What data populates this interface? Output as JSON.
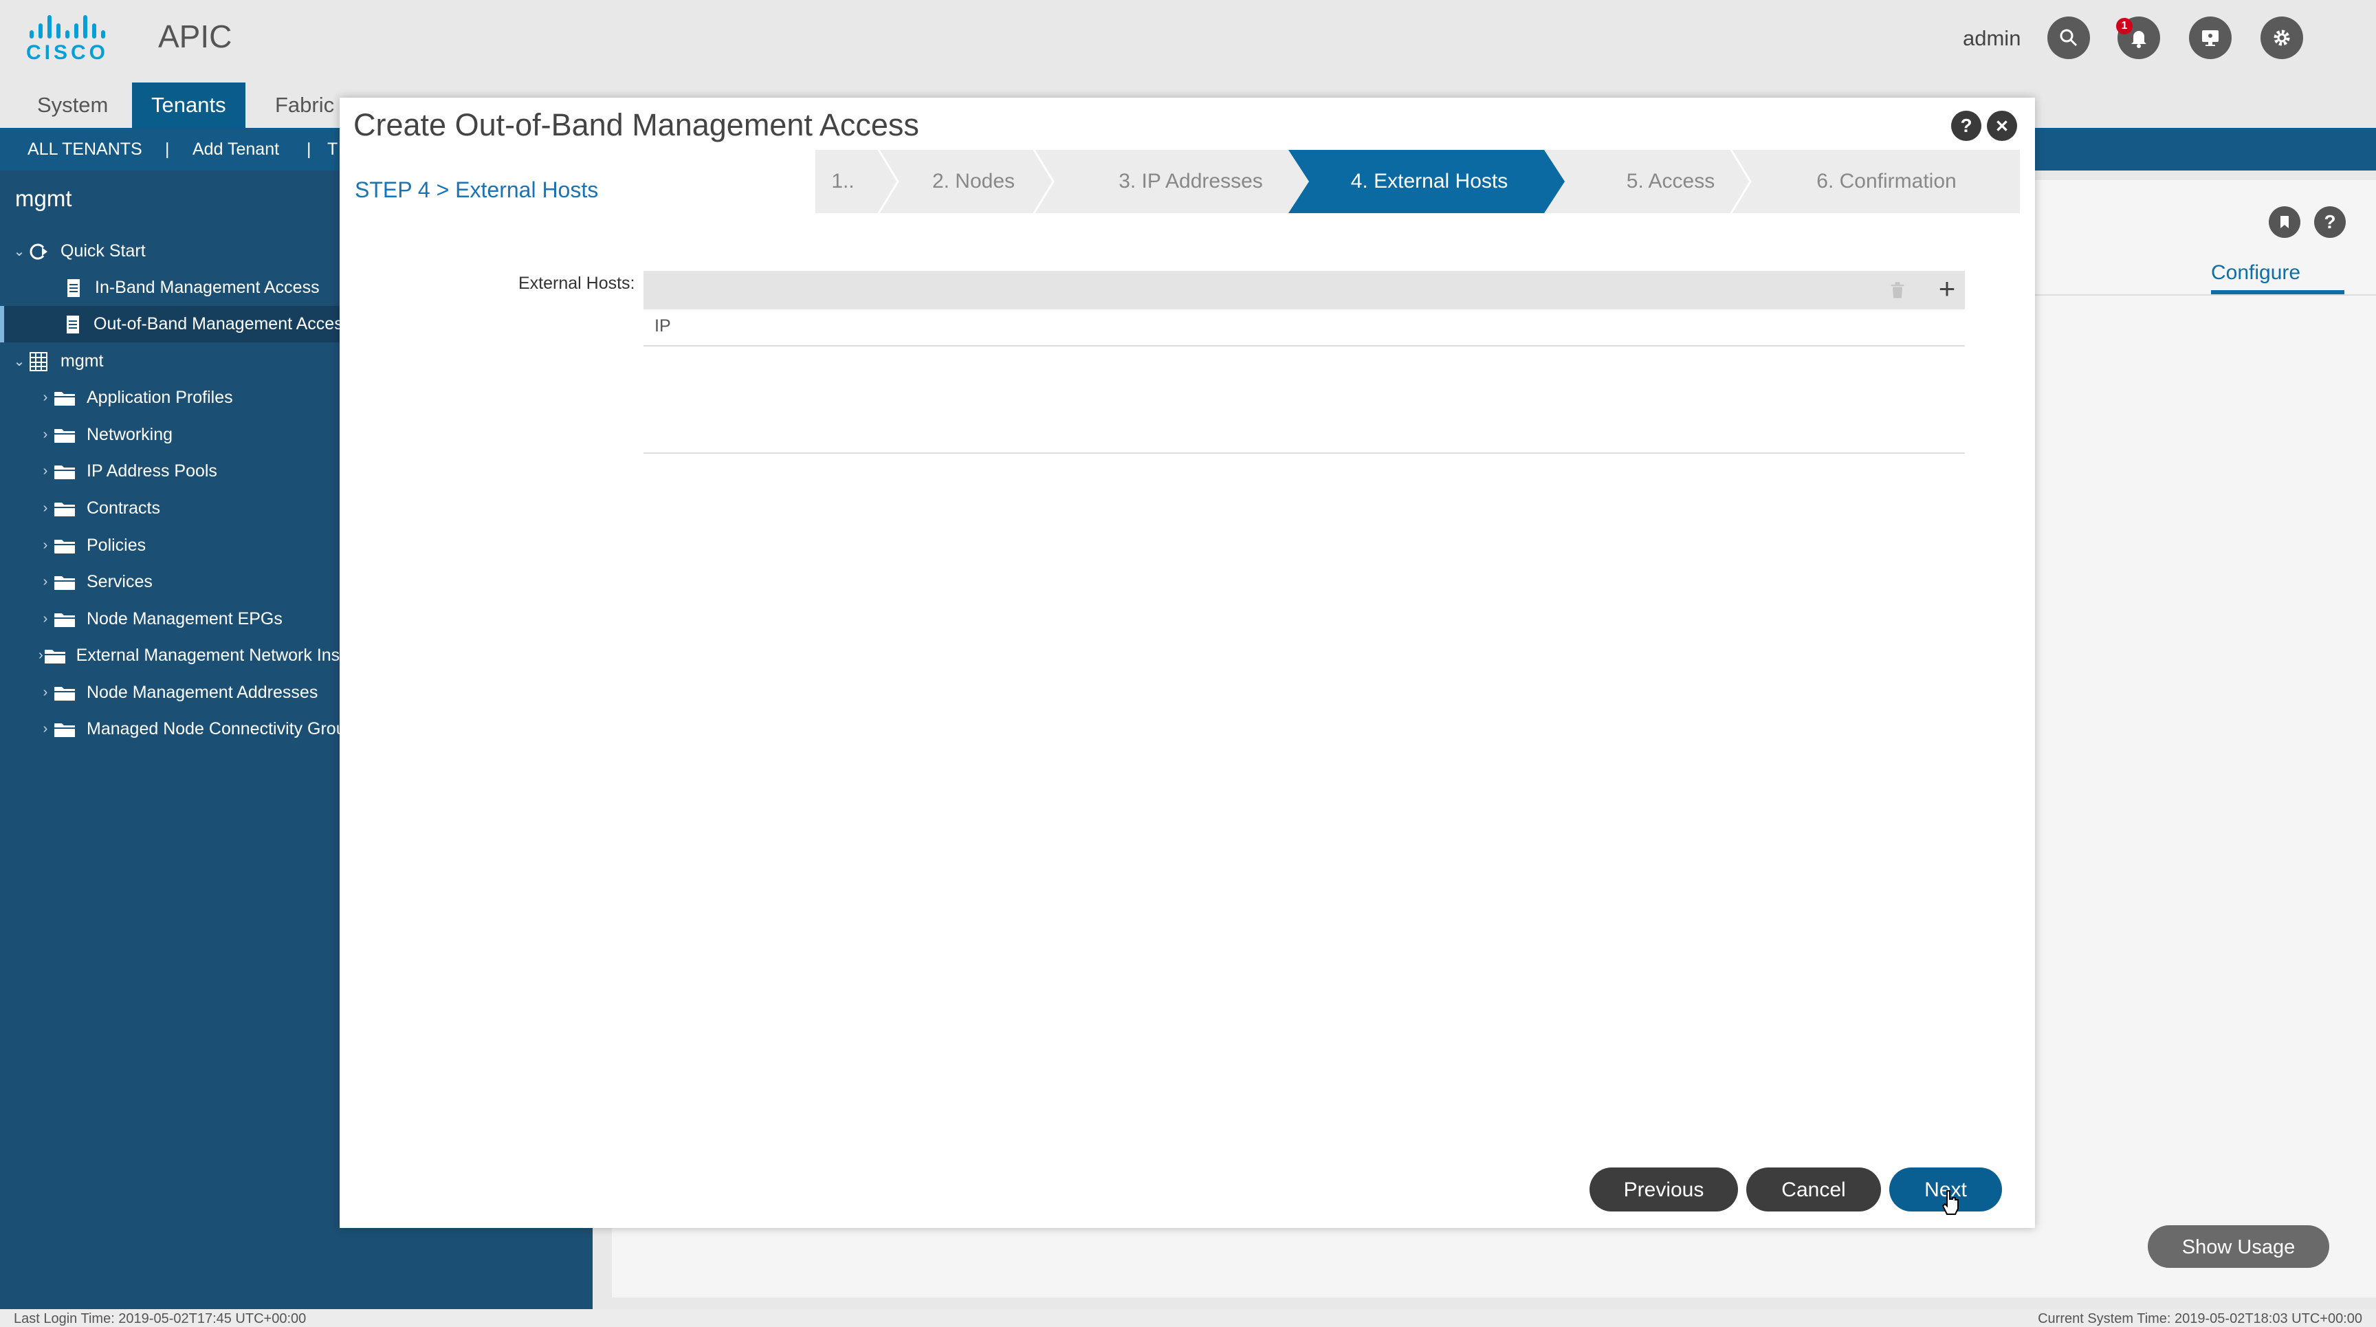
{
  "header": {
    "logo_text": "CISCO",
    "app_title": "APIC",
    "user": "admin",
    "notification_count": "1",
    "icons": [
      "search-icon",
      "bell-icon",
      "monitor-icon",
      "gear-icon"
    ]
  },
  "main_tabs": [
    {
      "label": "System"
    },
    {
      "label": "Tenants"
    },
    {
      "label": "Fabric"
    }
  ],
  "subnav": {
    "all_tenants": "ALL TENANTS",
    "separator": "|",
    "add_tenant": "Add Tenant",
    "partial": "T"
  },
  "sidebar": {
    "title": "mgmt",
    "items": [
      {
        "label": "Quick Start",
        "icon": "quickstart-icon"
      },
      {
        "label": "In-Band Management Access",
        "icon": "document-icon"
      },
      {
        "label": "Out-of-Band Management Access",
        "icon": "document-icon"
      },
      {
        "label": "mgmt",
        "icon": "tenant-grid-icon"
      },
      {
        "label": "Application Profiles",
        "icon": "folder-icon"
      },
      {
        "label": "Networking",
        "icon": "folder-icon"
      },
      {
        "label": "IP Address Pools",
        "icon": "folder-icon"
      },
      {
        "label": "Contracts",
        "icon": "folder-icon"
      },
      {
        "label": "Policies",
        "icon": "folder-icon"
      },
      {
        "label": "Services",
        "icon": "folder-icon"
      },
      {
        "label": "Node Management EPGs",
        "icon": "folder-icon"
      },
      {
        "label": "External Management Network Instance Profiles",
        "icon": "folder-icon"
      },
      {
        "label": "Node Management Addresses",
        "icon": "folder-icon"
      },
      {
        "label": "Managed Node Connectivity Groups",
        "icon": "folder-icon"
      }
    ]
  },
  "background_panel": {
    "configure_tab": "Configure",
    "show_usage": "Show Usage",
    "help_glyph": "?"
  },
  "modal": {
    "title": "Create Out-of-Band Management Access",
    "help_glyph": "?",
    "step_label": "STEP 4 > External Hosts",
    "steps": [
      {
        "label": "1.."
      },
      {
        "label": "2. Nodes"
      },
      {
        "label": "3. IP Addresses"
      },
      {
        "label": "4. External Hosts"
      },
      {
        "label": "5. Access"
      },
      {
        "label": "6. Confirmation"
      }
    ],
    "active_step": 4,
    "external_hosts_label": "External Hosts:",
    "add_glyph": "+",
    "table_columns": [
      "IP"
    ],
    "buttons": {
      "previous": "Previous",
      "cancel": "Cancel",
      "next": "Next"
    }
  },
  "status": {
    "last_login": "Last Login Time: 2019-05-02T17:45 UTC+00:00",
    "system_time": "Current System Time: 2019-05-02T18:03 UTC+00:00"
  },
  "colors": {
    "brand": "#049fd9",
    "nav_blue": "#155a87",
    "sidebar": "#1c4f74",
    "active_step": "#0a6aa1",
    "primary_button": "#0a5f92"
  }
}
